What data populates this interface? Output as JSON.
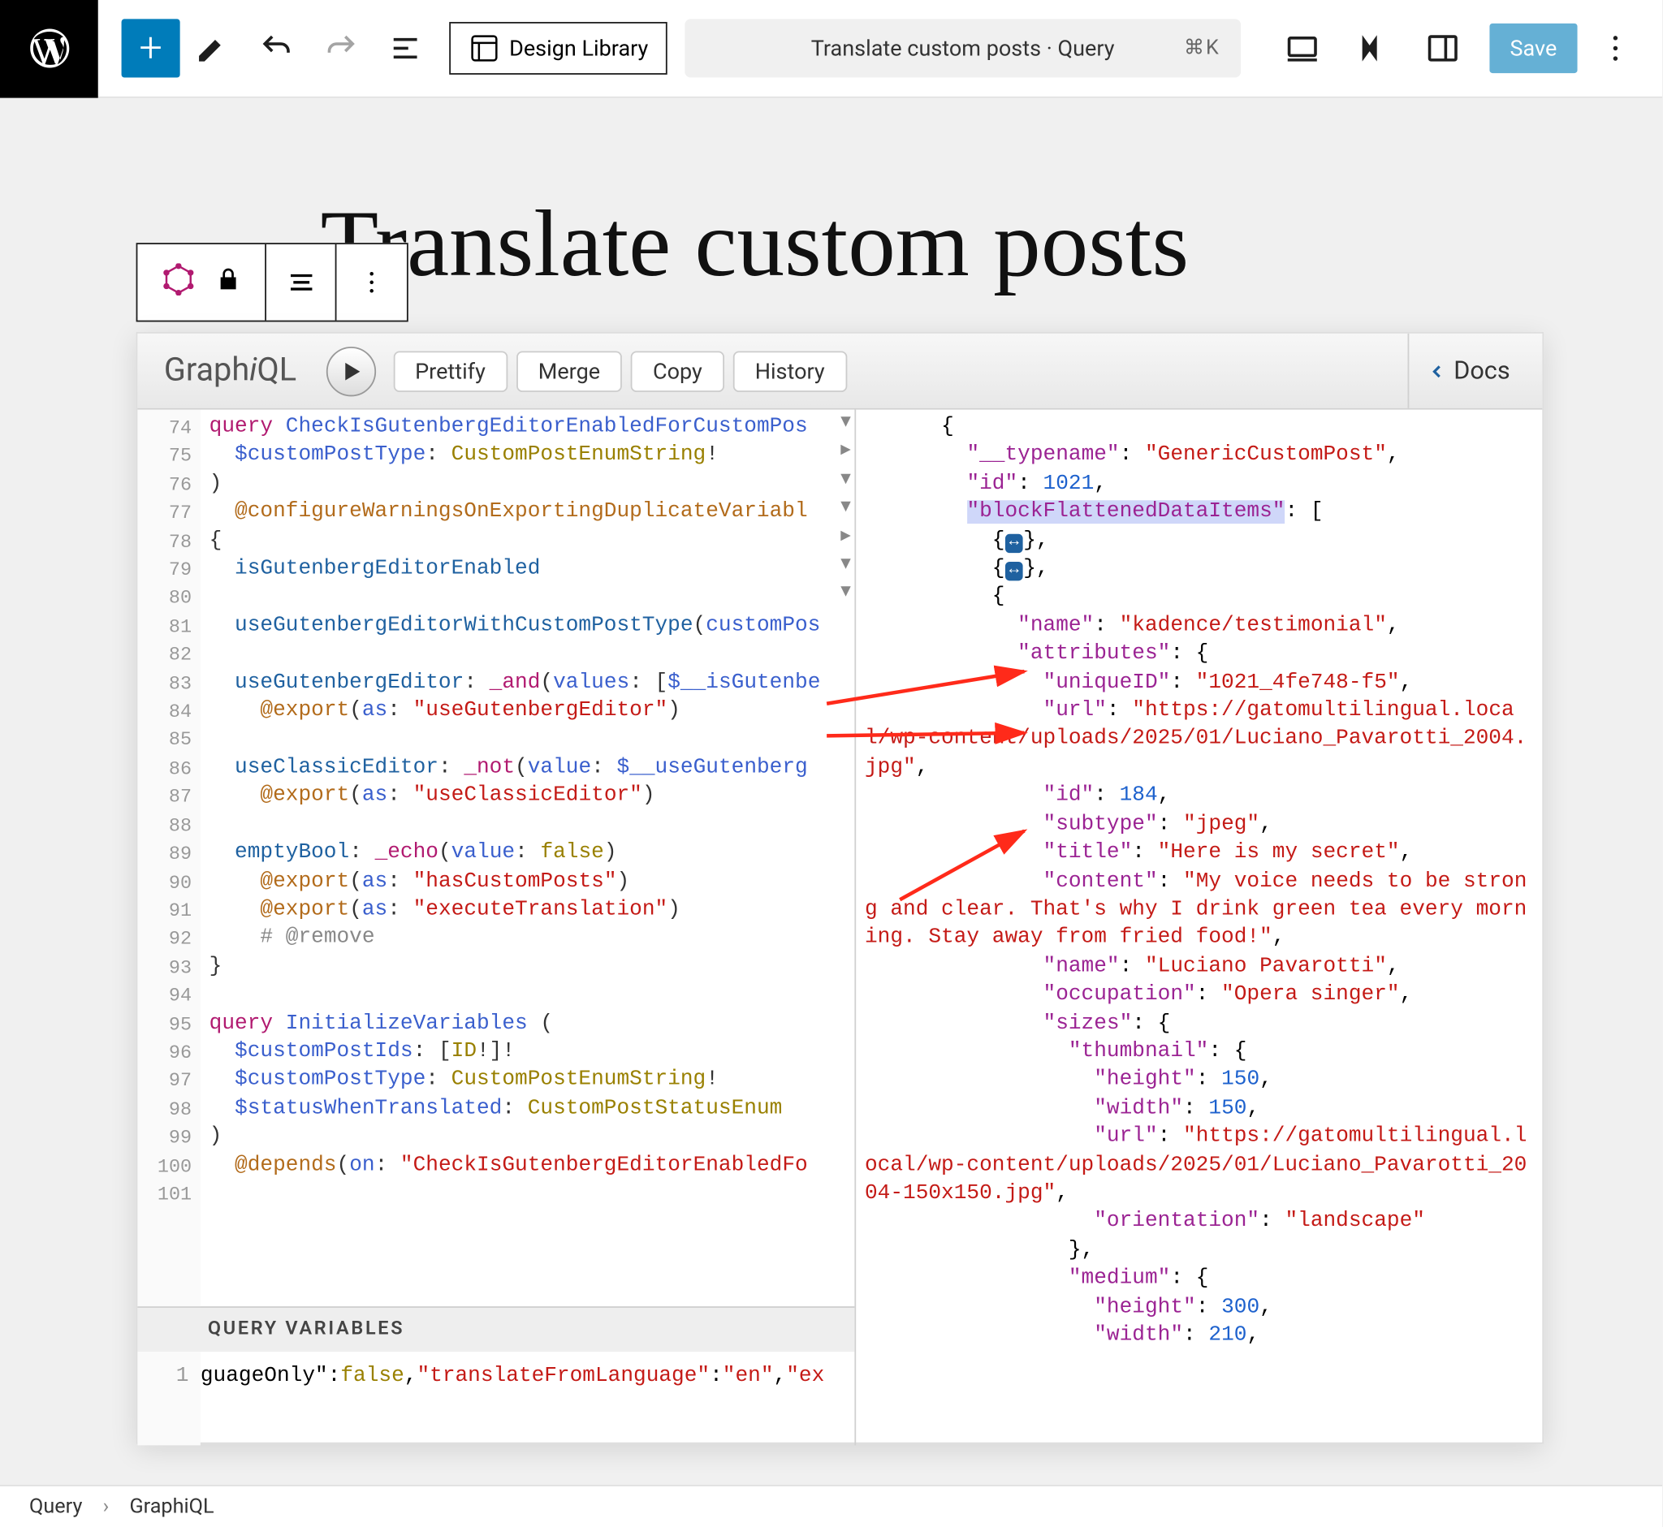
{
  "top": {
    "design_library": "Design Library",
    "command_bar": "Translate custom posts · Query",
    "shortcut": "⌘K",
    "save": "Save"
  },
  "page": {
    "title": "Translate custom posts"
  },
  "graphiql": {
    "title_a": "Graph",
    "title_i": "i",
    "title_b": "QL",
    "prettify": "Prettify",
    "merge": "Merge",
    "copy": "Copy",
    "history": "History",
    "docs": "Docs",
    "qv_label": "QUERY VARIABLES",
    "gutter_start": 74,
    "gutter_end": 101,
    "code_lines": [
      {
        "t": [
          {
            "c": "kw",
            "s": "query "
          },
          {
            "c": "fn",
            "s": "CheckIsGutenbergEditorEnabledForCustomPos"
          }
        ]
      },
      {
        "t": [
          {
            "c": "",
            "s": "  "
          },
          {
            "c": "var",
            "s": "$customPostType"
          },
          {
            "c": "",
            "s": ": "
          },
          {
            "c": "ty",
            "s": "CustomPostEnumString"
          },
          {
            "c": "",
            "s": "!"
          }
        ]
      },
      {
        "t": [
          {
            "c": "",
            "s": ")"
          }
        ]
      },
      {
        "t": [
          {
            "c": "",
            "s": "  "
          },
          {
            "c": "dec",
            "s": "@configureWarningsOnExportingDuplicateVariabl"
          }
        ]
      },
      {
        "t": [
          {
            "c": "",
            "s": "{"
          }
        ]
      },
      {
        "t": [
          {
            "c": "",
            "s": "  "
          },
          {
            "c": "fld",
            "s": "isGutenbergEditorEnabled"
          }
        ]
      },
      {
        "t": [
          {
            "c": "",
            "s": ""
          }
        ]
      },
      {
        "t": [
          {
            "c": "",
            "s": "  "
          },
          {
            "c": "fld",
            "s": "useGutenbergEditorWithCustomPostType"
          },
          {
            "c": "",
            "s": "("
          },
          {
            "c": "var",
            "s": "customPos"
          }
        ]
      },
      {
        "t": [
          {
            "c": "",
            "s": ""
          }
        ]
      },
      {
        "t": [
          {
            "c": "",
            "s": "  "
          },
          {
            "c": "fld",
            "s": "useGutenbergEditor"
          },
          {
            "c": "",
            "s": ": "
          },
          {
            "c": "nm",
            "s": "_and"
          },
          {
            "c": "",
            "s": "("
          },
          {
            "c": "var",
            "s": "values"
          },
          {
            "c": "",
            "s": ": ["
          },
          {
            "c": "var",
            "s": "$__isGutenbe"
          }
        ]
      },
      {
        "t": [
          {
            "c": "",
            "s": "    "
          },
          {
            "c": "dec",
            "s": "@export"
          },
          {
            "c": "",
            "s": "("
          },
          {
            "c": "var",
            "s": "as"
          },
          {
            "c": "",
            "s": ": "
          },
          {
            "c": "str",
            "s": "\"useGutenbergEditor\""
          },
          {
            "c": "",
            "s": ")"
          }
        ]
      },
      {
        "t": [
          {
            "c": "",
            "s": ""
          }
        ]
      },
      {
        "t": [
          {
            "c": "",
            "s": "  "
          },
          {
            "c": "fld",
            "s": "useClassicEditor"
          },
          {
            "c": "",
            "s": ": "
          },
          {
            "c": "nm",
            "s": "_not"
          },
          {
            "c": "",
            "s": "("
          },
          {
            "c": "var",
            "s": "value"
          },
          {
            "c": "",
            "s": ": "
          },
          {
            "c": "var",
            "s": "$__useGutenberg"
          }
        ]
      },
      {
        "t": [
          {
            "c": "",
            "s": "    "
          },
          {
            "c": "dec",
            "s": "@export"
          },
          {
            "c": "",
            "s": "("
          },
          {
            "c": "var",
            "s": "as"
          },
          {
            "c": "",
            "s": ": "
          },
          {
            "c": "str",
            "s": "\"useClassicEditor\""
          },
          {
            "c": "",
            "s": ")"
          }
        ]
      },
      {
        "t": [
          {
            "c": "",
            "s": ""
          }
        ]
      },
      {
        "t": [
          {
            "c": "",
            "s": "  "
          },
          {
            "c": "fld",
            "s": "emptyBool"
          },
          {
            "c": "",
            "s": ": "
          },
          {
            "c": "nm",
            "s": "_echo"
          },
          {
            "c": "",
            "s": "("
          },
          {
            "c": "var",
            "s": "value"
          },
          {
            "c": "",
            "s": ": "
          },
          {
            "c": "ty",
            "s": "false"
          },
          {
            "c": "",
            "s": ")"
          }
        ]
      },
      {
        "t": [
          {
            "c": "",
            "s": "    "
          },
          {
            "c": "dec",
            "s": "@export"
          },
          {
            "c": "",
            "s": "("
          },
          {
            "c": "var",
            "s": "as"
          },
          {
            "c": "",
            "s": ": "
          },
          {
            "c": "str",
            "s": "\"hasCustomPosts\""
          },
          {
            "c": "",
            "s": ")"
          }
        ]
      },
      {
        "t": [
          {
            "c": "",
            "s": "    "
          },
          {
            "c": "dec",
            "s": "@export"
          },
          {
            "c": "",
            "s": "("
          },
          {
            "c": "var",
            "s": "as"
          },
          {
            "c": "",
            "s": ": "
          },
          {
            "c": "str",
            "s": "\"executeTranslation\""
          },
          {
            "c": "",
            "s": ")"
          }
        ]
      },
      {
        "t": [
          {
            "c": "",
            "s": "    "
          },
          {
            "c": "cm",
            "s": "# @remove"
          }
        ]
      },
      {
        "t": [
          {
            "c": "",
            "s": "}"
          }
        ]
      },
      {
        "t": [
          {
            "c": "",
            "s": ""
          }
        ]
      },
      {
        "t": [
          {
            "c": "kw",
            "s": "query "
          },
          {
            "c": "fn",
            "s": "InitializeVariables"
          },
          {
            "c": "",
            "s": " ("
          }
        ]
      },
      {
        "t": [
          {
            "c": "",
            "s": "  "
          },
          {
            "c": "var",
            "s": "$customPostIds"
          },
          {
            "c": "",
            "s": ": ["
          },
          {
            "c": "ty",
            "s": "ID"
          },
          {
            "c": "",
            "s": "!]!"
          }
        ]
      },
      {
        "t": [
          {
            "c": "",
            "s": "  "
          },
          {
            "c": "var",
            "s": "$customPostType"
          },
          {
            "c": "",
            "s": ": "
          },
          {
            "c": "ty",
            "s": "CustomPostEnumString"
          },
          {
            "c": "",
            "s": "!"
          }
        ]
      },
      {
        "t": [
          {
            "c": "",
            "s": "  "
          },
          {
            "c": "var",
            "s": "$statusWhenTranslated"
          },
          {
            "c": "",
            "s": ": "
          },
          {
            "c": "ty",
            "s": "CustomPostStatusEnum"
          }
        ]
      },
      {
        "t": [
          {
            "c": "",
            "s": ")"
          }
        ]
      },
      {
        "t": [
          {
            "c": "",
            "s": "  "
          },
          {
            "c": "dec",
            "s": "@depends"
          },
          {
            "c": "",
            "s": "("
          },
          {
            "c": "var",
            "s": "on"
          },
          {
            "c": "",
            "s": ": "
          },
          {
            "c": "str",
            "s": "\"CheckIsGutenbergEditorEnabledFo"
          }
        ]
      }
    ],
    "fold_marks": [
      {
        "line": 77,
        "ch": "▾"
      },
      {
        "line": 78,
        "ch": "▸"
      },
      {
        "line": 79,
        "ch": "▾"
      },
      {
        "line": 82,
        "ch": "▾"
      },
      {
        "line": 87,
        "ch": "▸"
      },
      {
        "line": 95,
        "ch": "▾"
      },
      {
        "line": 96,
        "ch": "▾"
      }
    ],
    "qv_line": [
      {
        "c": "",
        "s": "guageOnly\""
      },
      {
        "c": "",
        "s": ":"
      },
      {
        "c": "ty",
        "s": "false"
      },
      {
        "c": "",
        "s": ","
      },
      {
        "c": "str",
        "s": "\"translateFromLanguage\""
      },
      {
        "c": "",
        "s": ":"
      },
      {
        "c": "str",
        "s": "\"en\""
      },
      {
        "c": "",
        "s": ","
      },
      {
        "c": "str",
        "s": "\"ex"
      }
    ],
    "result_lines": [
      "      {",
      "        <k>\"__typename\"</k>: <s>\"GenericCustomPost\"</s>,",
      "        <k>\"id\"</k>: <n>1021</n>,",
      "        <k><h>\"blockFlattenedDataItems\"</h></k>: [",
      "          {<p>↔</p>},",
      "          {<p>↔</p>},",
      "          {",
      "            <k>\"name\"</k>: <s>\"kadence/testimonial\"</s>,",
      "            <k>\"attributes\"</k>: {",
      "              <k>\"uniqueID\"</k>: <s>\"1021_4fe748-f5\"</s>,",
      "              <k>\"url\"</k>: <s>\"https://gatomultilingual.local/wp-content/uploads/2025/01/Luciano_Pavarotti_2004.jpg\"</s>,",
      "              <k>\"id\"</k>: <n>184</n>,",
      "              <k>\"subtype\"</k>: <s>\"jpeg\"</s>,",
      "              <k>\"title\"</k>: <s>\"Here is my secret\"</s>,",
      "              <k>\"content\"</k>: <s>\"My voice needs to be strong and clear. That's why I drink green tea every morning. Stay away from fried food!\"</s>,",
      "              <k>\"name\"</k>: <s>\"Luciano Pavarotti\"</s>,",
      "              <k>\"occupation\"</k>: <s>\"Opera singer\"</s>,",
      "              <k>\"sizes\"</k>: {",
      "                <k>\"thumbnail\"</k>: {",
      "                  <k>\"height\"</k>: <n>150</n>,",
      "                  <k>\"width\"</k>: <n>150</n>,",
      "                  <k>\"url\"</k>: <s>\"https://gatomultilingual.local/wp-content/uploads/2025/01/Luciano_Pavarotti_2004-150x150.jpg\"</s>,",
      "                  <k>\"orientation\"</k>: <s>\"landscape\"</s>",
      "                },",
      "                <k>\"medium\"</k>: {",
      "                  <k>\"height\"</k>: <n>300</n>,",
      "                  <k>\"width\"</k>: <n>210</n>,"
    ]
  },
  "footer": {
    "crumb1": "Query",
    "crumb2": "GraphiQL"
  }
}
